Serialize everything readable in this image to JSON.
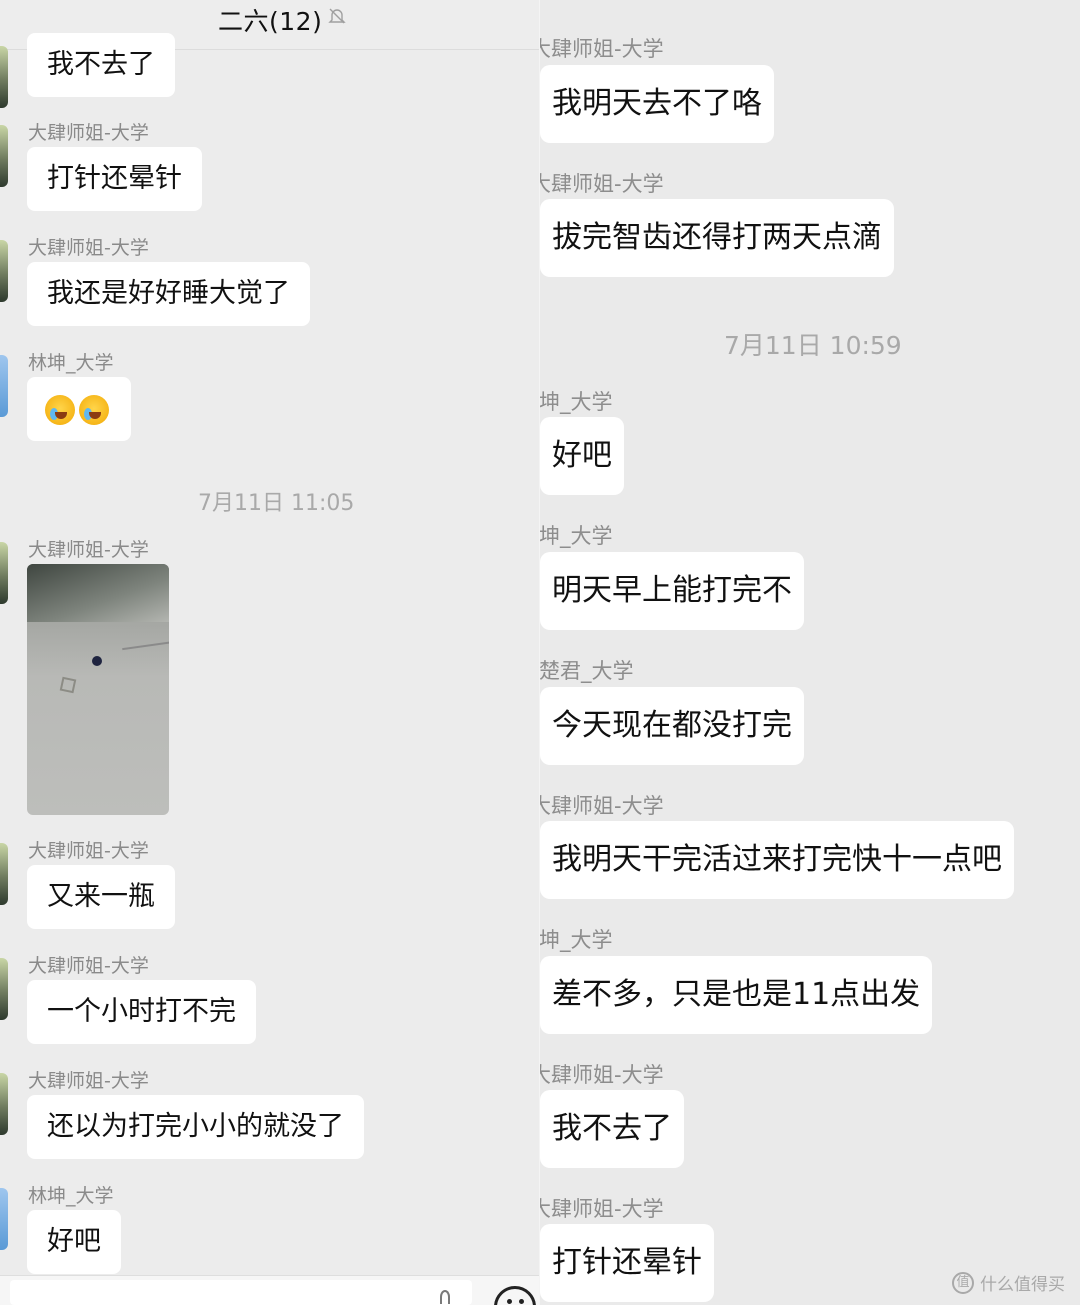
{
  "left": {
    "title": "二六(12)",
    "messages": [
      {
        "sender": "",
        "text": "我不去了"
      },
      {
        "sender": "大肆师姐-大学",
        "text": "打针还晕针"
      },
      {
        "sender": "大肆师姐-大学",
        "text": "我还是好好睡大觉了"
      },
      {
        "sender": "林坤_大学",
        "text": ""
      },
      {
        "sender": "大肆师姐-大学",
        "text": ""
      },
      {
        "sender": "大肆师姐-大学",
        "text": "又来一瓶"
      },
      {
        "sender": "大肆师姐-大学",
        "text": "一个小时打不完"
      },
      {
        "sender": "大肆师姐-大学",
        "text": "还以为打完小小的就没了"
      },
      {
        "sender": "林坤_大学",
        "text": "好吧"
      }
    ],
    "timestamp": "7月11日 11:05"
  },
  "right": {
    "messages": [
      {
        "sender": "大肆师姐-大学",
        "text": "我明天去不了咯"
      },
      {
        "sender": "大肆师姐-大学",
        "text": "拔完智齿还得打两天点滴"
      },
      {
        "sender": "林坤_大学",
        "text": "好吧"
      },
      {
        "sender": "林坤_大学",
        "text": "明天早上能打完不"
      },
      {
        "sender": "赵楚君_大学",
        "text": "今天现在都没打完"
      },
      {
        "sender": "大肆师姐-大学",
        "text": "我明天干完活过来打完快十一点吧"
      },
      {
        "sender": "林坤_大学",
        "text": "差不多，只是也是11点出发"
      },
      {
        "sender": "大肆师姐-大学",
        "text": "我不去了"
      },
      {
        "sender": "大肆师姐-大学",
        "text": "打针还晕针"
      }
    ],
    "timestamp": "7月11日 10:59"
  },
  "watermark": "什么值得买",
  "icons": {
    "mute": "bell-off-icon",
    "emoji": "crying-laughing-emoji-icon",
    "emoji_button": "smiley-icon",
    "watermark": "zhi-logo-icon"
  }
}
